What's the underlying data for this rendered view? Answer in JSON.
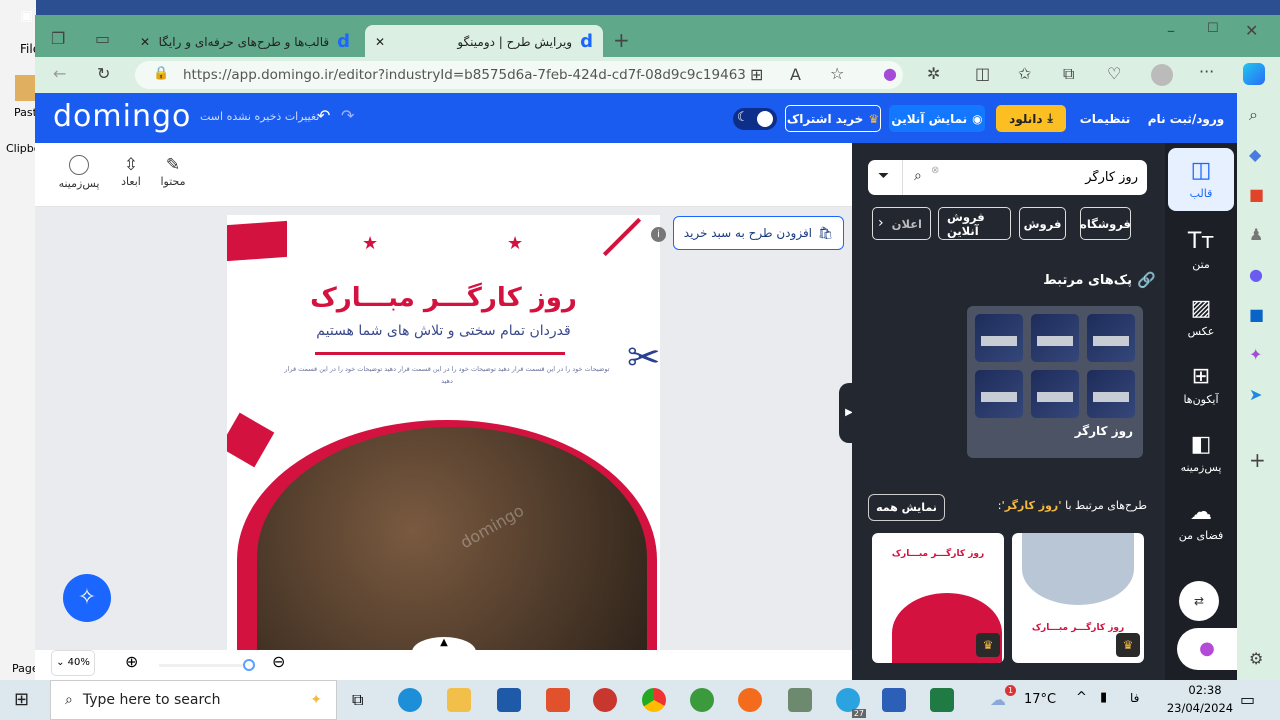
{
  "desktop": {
    "word_labels": [
      "File",
      "Paste",
      "Clipbo",
      "Page"
    ]
  },
  "browser": {
    "tabs": [
      {
        "title": "قالب‌ها و طرح‌های حرفه‌ای و رایگان",
        "active": false
      },
      {
        "title": "ویرایش طرح | دومینگو",
        "active": true
      }
    ],
    "url": "https://app.domingo.ir/editor?industryId=b8575d6a-7feb-424d-cd7f-08d9c9c19463"
  },
  "header": {
    "logo": "domingo",
    "save_status": "تغییرات ذخیره نشده است",
    "subscribe": "خرید اشتراک",
    "preview": "نمایش آنلاین",
    "download": "دانلود",
    "settings": "تنظیمات",
    "login": "ورود/ثبت نام",
    "colors": {
      "header": "#1a5cf0",
      "download": "#fbbf24"
    }
  },
  "toolbar": {
    "content": "محتوا",
    "dimensions": "ابعاد",
    "background": "پس‌زمینه"
  },
  "canvas": {
    "add_to_cart": "افزودن طرح به سبد خرید",
    "design": {
      "title": "روز کارگـــر مبـــارک",
      "subtitle": "قدردان تمام سختی و تلاش های شما هستیم",
      "body": "توضیحات خود را در این قسمت قرار دهید توضیحات خود را در این قسمت قرار دهید توضیحات خود را در این قسمت قرار دهید",
      "watermark": "domingo"
    }
  },
  "zoom": {
    "level": "40%",
    "slider_fraction": 1.0
  },
  "panel": {
    "search_value": "روز کارگر",
    "chips": [
      "فروشگاه",
      "فروش",
      "فروش آنلاین",
      "اعلان"
    ],
    "packs_title": "پک‌های مرتبط",
    "pack_name": "روز کارگر",
    "related_prefix": "طرح‌های مرتبط با",
    "related_query": "'روز کارگر'",
    "show_all": "نمایش همه",
    "card_title": "روز کارگـــر مبـــارک"
  },
  "rail": [
    {
      "label": "قالب",
      "icon": "template-icon",
      "active": true
    },
    {
      "label": "متن",
      "icon": "text-icon"
    },
    {
      "label": "عکس",
      "icon": "image-icon"
    },
    {
      "label": "آیکون‌ها",
      "icon": "icons-icon"
    },
    {
      "label": "پس‌زمینه",
      "icon": "background-icon"
    },
    {
      "label": "فضای من",
      "icon": "upload-cloud-icon"
    }
  ],
  "taskbar": {
    "search_placeholder": "Type here to search",
    "temperature": "17°C",
    "lang": "فا",
    "time": "02:38",
    "date": "23/04/2024",
    "telegram_badge": "27",
    "weather_badge": "1"
  }
}
